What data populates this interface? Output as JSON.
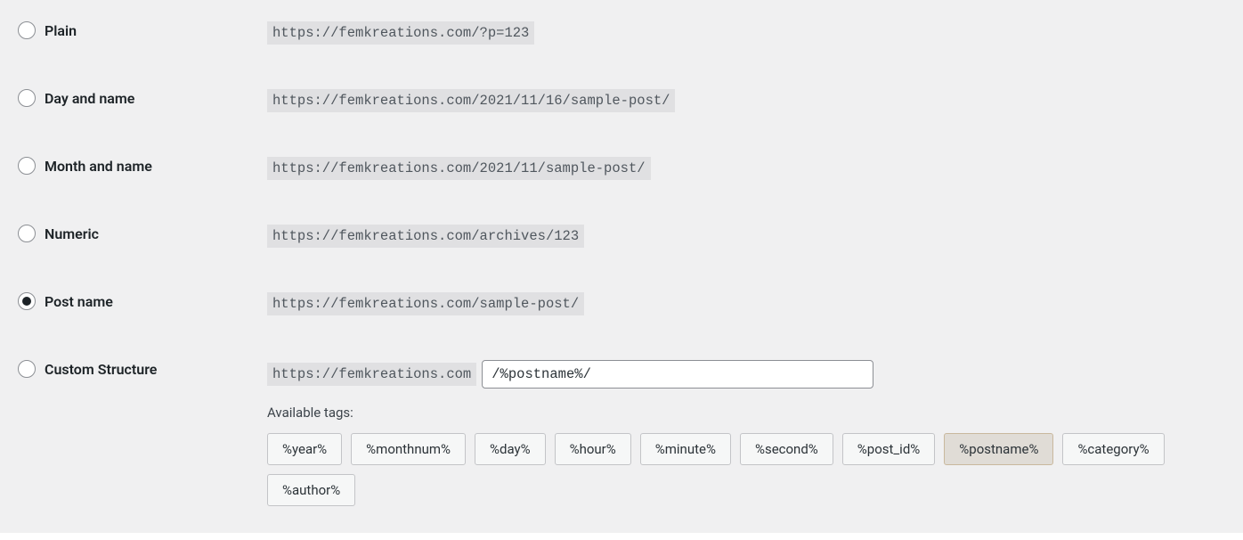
{
  "options": [
    {
      "key": "plain",
      "label": "Plain",
      "example": "https://femkreations.com/?p=123",
      "selected": false
    },
    {
      "key": "day-name",
      "label": "Day and name",
      "example": "https://femkreations.com/2021/11/16/sample-post/",
      "selected": false
    },
    {
      "key": "month-name",
      "label": "Month and name",
      "example": "https://femkreations.com/2021/11/sample-post/",
      "selected": false
    },
    {
      "key": "numeric",
      "label": "Numeric",
      "example": "https://femkreations.com/archives/123",
      "selected": false
    },
    {
      "key": "post-name",
      "label": "Post name",
      "example": "https://femkreations.com/sample-post/",
      "selected": true
    }
  ],
  "custom": {
    "label": "Custom Structure",
    "base_url": "https://femkreations.com",
    "value": "/%postname%/",
    "available_label": "Available tags:",
    "tags": [
      {
        "text": "%year%",
        "active": false
      },
      {
        "text": "%monthnum%",
        "active": false
      },
      {
        "text": "%day%",
        "active": false
      },
      {
        "text": "%hour%",
        "active": false
      },
      {
        "text": "%minute%",
        "active": false
      },
      {
        "text": "%second%",
        "active": false
      },
      {
        "text": "%post_id%",
        "active": false
      },
      {
        "text": "%postname%",
        "active": true
      },
      {
        "text": "%category%",
        "active": false
      },
      {
        "text": "%author%",
        "active": false
      }
    ]
  }
}
